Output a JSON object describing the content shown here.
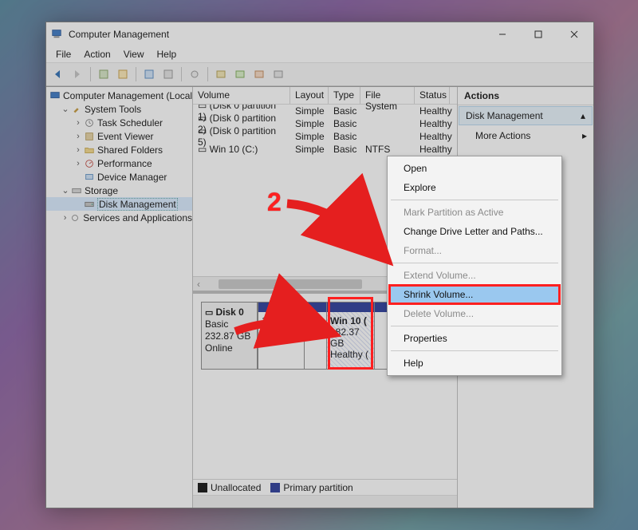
{
  "window": {
    "title": "Computer Management"
  },
  "menu": {
    "file": "File",
    "action": "Action",
    "view": "View",
    "help": "Help"
  },
  "tree": {
    "root": "Computer Management (Local)",
    "system_tools": "System Tools",
    "task_scheduler": "Task Scheduler",
    "event_viewer": "Event Viewer",
    "shared_folders": "Shared Folders",
    "performance": "Performance",
    "device_manager": "Device Manager",
    "storage": "Storage",
    "disk_management": "Disk Management",
    "services_apps": "Services and Applications"
  },
  "volumes": {
    "headers": {
      "volume": "Volume",
      "layout": "Layout",
      "type": "Type",
      "fs": "File System",
      "status": "Status"
    },
    "rows": [
      {
        "volume": "(Disk 0 partition 1)",
        "layout": "Simple",
        "type": "Basic",
        "fs": "",
        "status": "Healthy"
      },
      {
        "volume": "(Disk 0 partition 2)",
        "layout": "Simple",
        "type": "Basic",
        "fs": "",
        "status": "Healthy"
      },
      {
        "volume": "(Disk 0 partition 5)",
        "layout": "Simple",
        "type": "Basic",
        "fs": "",
        "status": "Healthy"
      },
      {
        "volume": "Win 10 (C:)",
        "layout": "Simple",
        "type": "Basic",
        "fs": "NTFS",
        "status": "Healthy"
      }
    ]
  },
  "disk": {
    "label": "Disk 0",
    "type": "Basic",
    "size": "232.87 GB",
    "state": "Online",
    "p1": {
      "line1": "100",
      "line2": "He"
    },
    "p2": {
      "line1": "",
      "line2": ""
    },
    "win": {
      "name": "Win 10  (",
      "size": "182.37 GB",
      "health": "Healthy ("
    }
  },
  "legend": {
    "unallocated": "Unallocated",
    "primary": "Primary partition"
  },
  "actions_panel": {
    "title": "Actions",
    "dm": "Disk Management",
    "more": "More Actions"
  },
  "context": {
    "open": "Open",
    "explore": "Explore",
    "mark": "Mark Partition as Active",
    "change": "Change Drive Letter and Paths...",
    "format": "Format...",
    "extend": "Extend Volume...",
    "shrink": "Shrink Volume...",
    "delete": "Delete Volume...",
    "properties": "Properties",
    "help": "Help"
  },
  "annotations": {
    "two": "2"
  }
}
